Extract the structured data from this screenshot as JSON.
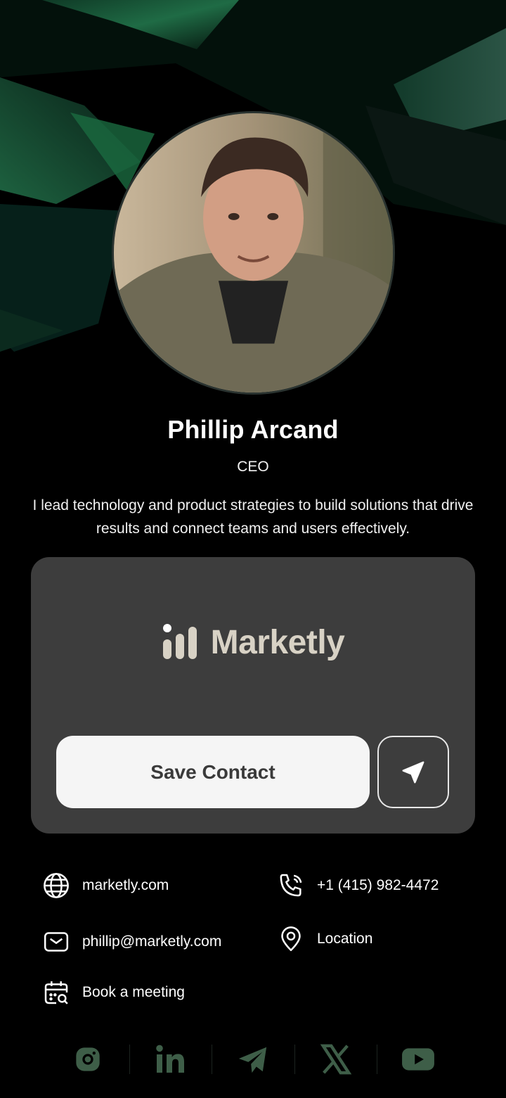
{
  "profile": {
    "name": "Phillip Arcand",
    "role": "CEO",
    "bio": "I lead technology and product strategies to build solutions that drive results and connect teams and users effectively."
  },
  "card": {
    "brand_name": "Marketly",
    "save_label": "Save Contact",
    "share_icon": "send-icon"
  },
  "contacts": [
    {
      "icon": "globe-icon",
      "label": "marketly.com"
    },
    {
      "icon": "phone-icon",
      "label": "+1 (415) 982-4472"
    },
    {
      "icon": "mail-icon",
      "label": "phillip@marketly.com"
    },
    {
      "icon": "location-icon",
      "label": "Location"
    },
    {
      "icon": "calendar-icon",
      "label": "Book a meeting"
    }
  ],
  "socials": [
    "instagram-icon",
    "linkedin-icon",
    "telegram-icon",
    "x-icon",
    "youtube-icon"
  ],
  "colors": {
    "background": "#000000",
    "card": "#3d3d3d",
    "accent_green": "#3e5e48",
    "brand_beige": "#d8d2c5"
  }
}
